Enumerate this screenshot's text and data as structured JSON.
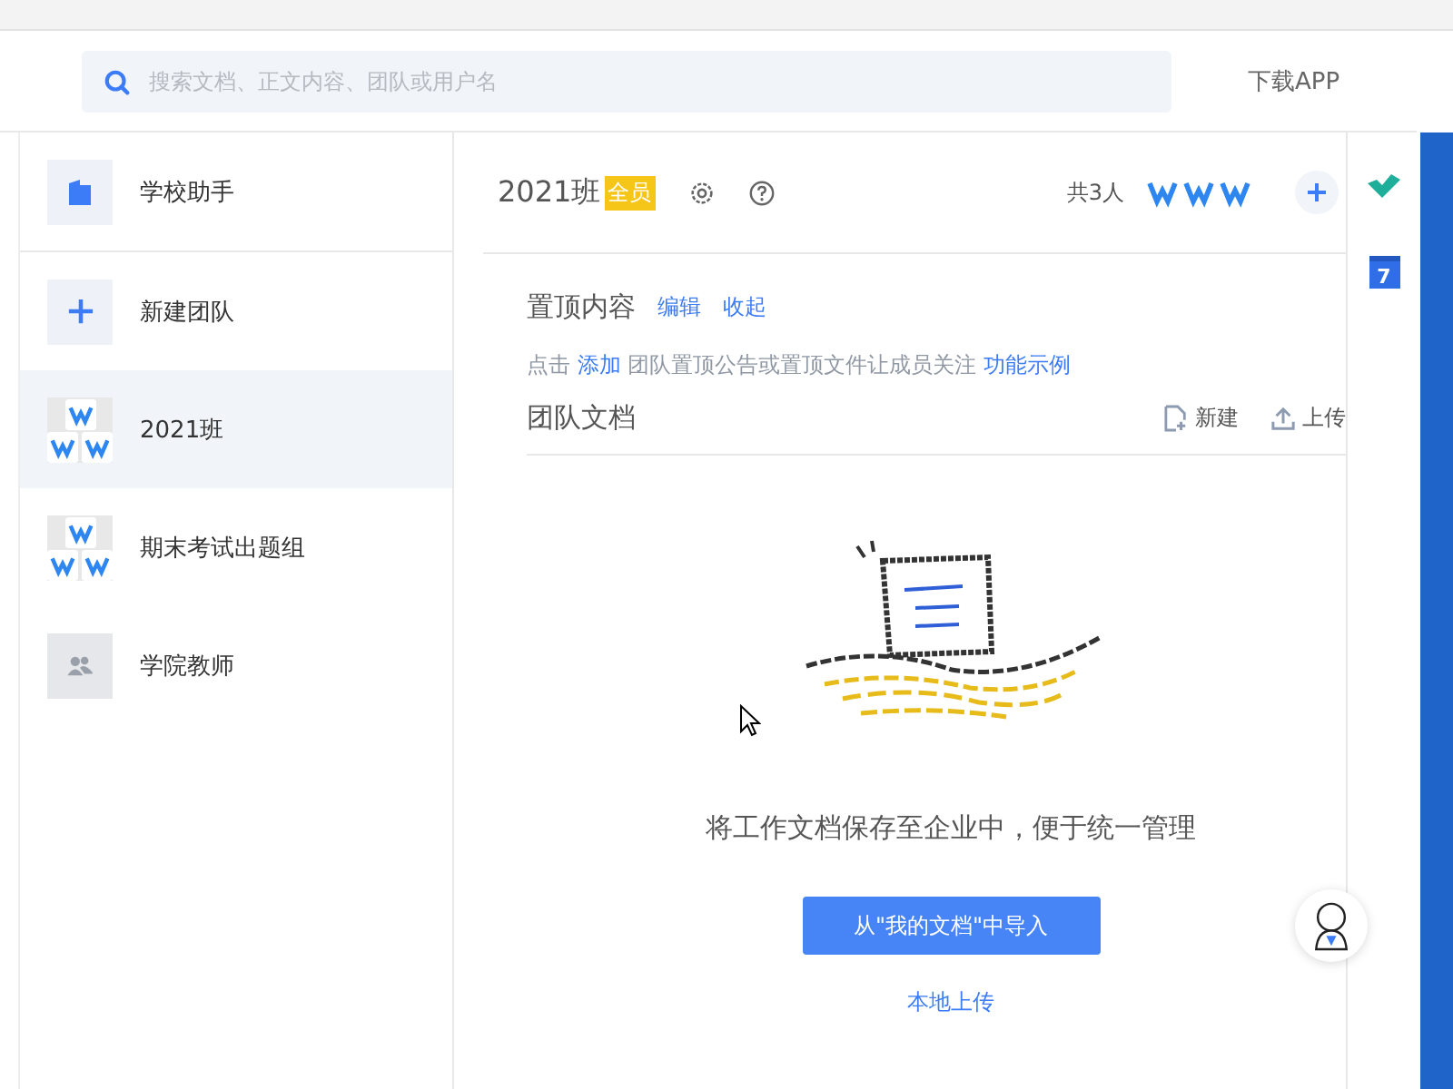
{
  "search": {
    "placeholder": "搜索文档、正文内容、团队或用户名"
  },
  "download": "下载APP",
  "sidebar": {
    "items": [
      {
        "label": "学校助手",
        "kind": "assistant",
        "selected": false
      },
      {
        "label": "新建团队",
        "kind": "new",
        "selected": false
      },
      {
        "label": "2021班",
        "kind": "team",
        "selected": true
      },
      {
        "label": "期末考试出题组",
        "kind": "team",
        "selected": false
      },
      {
        "label": "学院教师",
        "kind": "people",
        "selected": false
      }
    ]
  },
  "team": {
    "name": "2021班",
    "badge": "全员",
    "member_count": "共3人"
  },
  "pinned": {
    "title": "置顶内容",
    "actions": [
      "编辑",
      "收起"
    ],
    "hint": [
      {
        "text": "点击 ",
        "kind": "text"
      },
      {
        "text": "添加",
        "kind": "link"
      },
      {
        "text": " 团队置顶公告或置顶文件让成员关注 ",
        "kind": "text"
      },
      {
        "text": "功能示例",
        "kind": "link"
      }
    ]
  },
  "docs": {
    "title": "团队文档",
    "actions": [
      {
        "label": "新建",
        "kind": "new"
      },
      {
        "label": "上传",
        "kind": "upload"
      }
    ]
  },
  "empty": {
    "message": "将工作文档保存至企业中，便于统一管理",
    "primary_button": "从\"我的文档\"中导入",
    "secondary_link": "本地上传"
  },
  "rail": {
    "calendar_day": "7"
  }
}
